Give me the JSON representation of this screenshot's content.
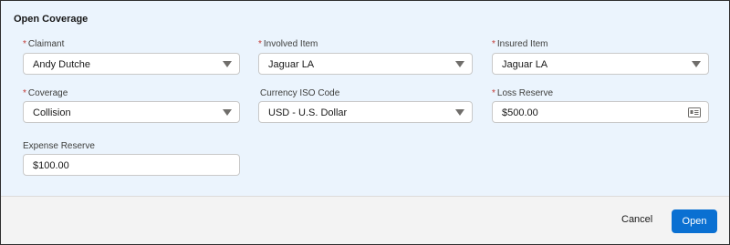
{
  "modal": {
    "title": "Open Coverage"
  },
  "fields": {
    "claimant": {
      "label": "Claimant",
      "required": true,
      "value": "Andy Dutche"
    },
    "involved_item": {
      "label": "Involved Item",
      "required": true,
      "value": "Jaguar LA"
    },
    "insured_item": {
      "label": "Insured Item",
      "required": true,
      "value": "Jaguar LA"
    },
    "coverage": {
      "label": "Coverage",
      "required": true,
      "value": "Collision"
    },
    "currency": {
      "label": "Currency ISO Code",
      "required": false,
      "value": "USD - U.S. Dollar"
    },
    "loss_reserve": {
      "label": "Loss Reserve",
      "required": true,
      "value": "$500.00"
    },
    "expense_reserve": {
      "label": "Expense Reserve",
      "required": false,
      "value": "$100.00"
    }
  },
  "required_marker": "*",
  "footer": {
    "cancel_label": "Cancel",
    "open_label": "Open"
  },
  "colors": {
    "panel_bg": "#ebf4fd",
    "footer_bg": "#f3f3f3",
    "brand_button": "#0a70d2",
    "required": "#c23934"
  },
  "icons": {
    "dropdown": "chevron-down-icon",
    "loss_reserve_input": "card-icon"
  }
}
